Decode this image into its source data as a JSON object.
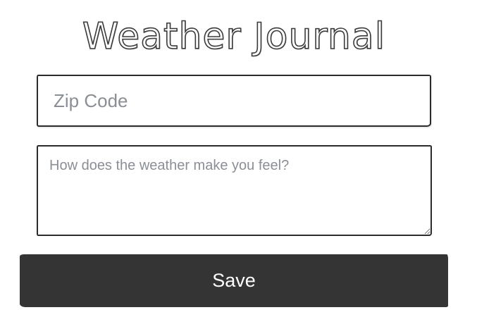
{
  "app": {
    "title": "Weather Journal"
  },
  "form": {
    "zip": {
      "value": "",
      "placeholder": "Zip Code"
    },
    "feelings": {
      "value": "",
      "placeholder": "How does the weather make you feel?"
    },
    "save_label": "Save"
  }
}
